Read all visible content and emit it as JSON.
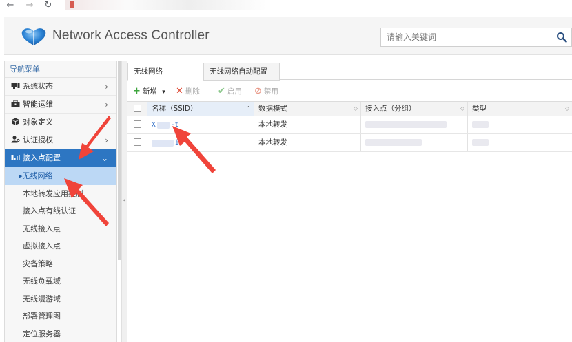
{
  "browser": {
    "back": "←",
    "forward": "→",
    "reload": "↻"
  },
  "app": {
    "title": "Network Access Controller"
  },
  "search": {
    "placeholder": "请输入关键词"
  },
  "sidebar": {
    "title": "导航菜单",
    "items": [
      {
        "label": "系统状态",
        "icon": "monitor-icon",
        "chevron": "›"
      },
      {
        "label": "智能运维",
        "icon": "toolbox-icon",
        "chevron": "›"
      },
      {
        "label": "对象定义",
        "icon": "cube-icon",
        "chevron": "›"
      },
      {
        "label": "认证授权",
        "icon": "user-key-icon",
        "chevron": "›"
      },
      {
        "label": "接入点配置",
        "icon": "signal-icon",
        "chevron": "⌄"
      }
    ],
    "sub_items": [
      "▸无线网络",
      "本地转发应用控制",
      "接入点有线认证",
      "无线接入点",
      "虚拟接入点",
      "灾备策略",
      "无线负载域",
      "无线漫游域",
      "部署管理图",
      "定位服务器"
    ]
  },
  "tabs": [
    "无线网络",
    "无线网络自动配置"
  ],
  "toolbar": {
    "add": "新增",
    "add_icon": "+",
    "dropdown": "▾",
    "delete": "删除",
    "delete_icon": "✕",
    "enable": "启用",
    "enable_icon": "✔",
    "disable": "禁用",
    "disable_icon": "⊘"
  },
  "grid": {
    "columns": [
      "名称（SSID）",
      "数据模式",
      "接入点（分组）",
      "类型"
    ],
    "sort_up": "⌃",
    "sort_both": "◇",
    "rows": [
      {
        "ssid_start": "X",
        "ssid_end": "-t",
        "mode": "本地转发"
      },
      {
        "ssid_start": "",
        "ssid_end": "i",
        "mode": "本地转发"
      }
    ]
  },
  "colors": {
    "active_menu": "#2d76c2",
    "selected_sub": "#bcd8f5",
    "link": "#2a6bc6",
    "add_green": "#3da53d",
    "delete_red": "#e0503c",
    "annotation_red": "#f0443a"
  }
}
